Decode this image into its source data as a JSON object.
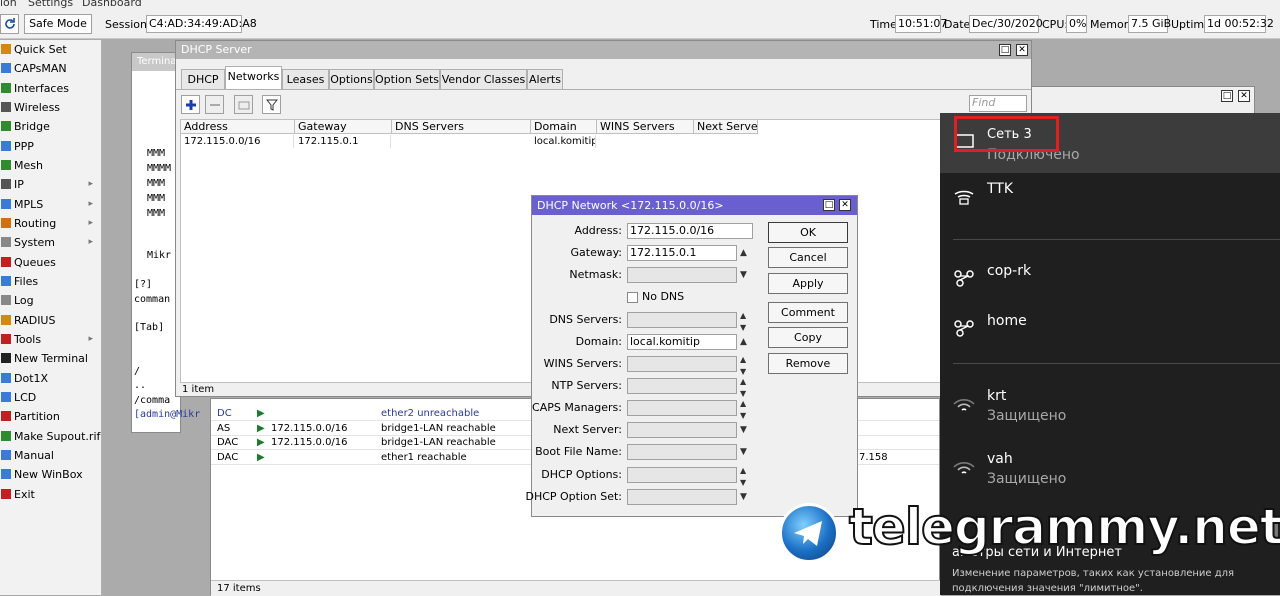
{
  "menu": [
    "ion",
    "Settings",
    "Dashboard"
  ],
  "toolbar": {
    "safe_mode": "Safe Mode",
    "session_label": "Session:",
    "session_value": "C4:AD:34:49:AD:A8",
    "time_label": "Time:",
    "time_value": "10:51:07",
    "date_label": "Date:",
    "date_value": "Dec/30/2020",
    "cpu_label": "CPU:",
    "cpu_value": "0%",
    "memory_label": "Memory:",
    "memory_value": "7.5 GiB",
    "uptime_label": "Uptime:",
    "uptime_value": "1d 00:52:32"
  },
  "sidebar": {
    "items": [
      {
        "label": "Quick Set",
        "icon": "quick-set-icon",
        "color": "#d08a10",
        "submenu": false
      },
      {
        "label": "CAPsMAN",
        "icon": "capsman-icon",
        "color": "#3a7bd5",
        "submenu": false
      },
      {
        "label": "Interfaces",
        "icon": "interfaces-icon",
        "color": "#2e8b2e",
        "submenu": false
      },
      {
        "label": "Wireless",
        "icon": "wireless-icon",
        "color": "#555555",
        "submenu": false
      },
      {
        "label": "Bridge",
        "icon": "bridge-icon",
        "color": "#2e8b2e",
        "submenu": false
      },
      {
        "label": "PPP",
        "icon": "ppp-icon",
        "color": "#3a7bd5",
        "submenu": false
      },
      {
        "label": "Mesh",
        "icon": "mesh-icon",
        "color": "#2e8b2e",
        "submenu": false
      },
      {
        "label": "IP",
        "icon": "ip-icon",
        "color": "#555555",
        "submenu": true
      },
      {
        "label": "MPLS",
        "icon": "mpls-icon",
        "color": "#3a7bd5",
        "submenu": true
      },
      {
        "label": "Routing",
        "icon": "routing-icon",
        "color": "#d07010",
        "submenu": true
      },
      {
        "label": "System",
        "icon": "system-icon",
        "color": "#888888",
        "submenu": true
      },
      {
        "label": "Queues",
        "icon": "queues-icon",
        "color": "#c02020",
        "submenu": false
      },
      {
        "label": "Files",
        "icon": "files-icon",
        "color": "#3a7bd5",
        "submenu": false
      },
      {
        "label": "Log",
        "icon": "log-icon",
        "color": "#888888",
        "submenu": false
      },
      {
        "label": "RADIUS",
        "icon": "radius-icon",
        "color": "#d08a10",
        "submenu": false
      },
      {
        "label": "Tools",
        "icon": "tools-icon",
        "color": "#c02020",
        "submenu": true
      },
      {
        "label": "New Terminal",
        "icon": "terminal-icon",
        "color": "#222222",
        "submenu": false
      },
      {
        "label": "Dot1X",
        "icon": "dot1x-icon",
        "color": "#3a7bd5",
        "submenu": false
      },
      {
        "label": "LCD",
        "icon": "lcd-icon",
        "color": "#3a7bd5",
        "submenu": false
      },
      {
        "label": "Partition",
        "icon": "partition-icon",
        "color": "#c02020",
        "submenu": false
      },
      {
        "label": "Make Supout.rif",
        "icon": "supout-icon",
        "color": "#2e8b2e",
        "submenu": false
      },
      {
        "label": "Manual",
        "icon": "manual-icon",
        "color": "#3a7bd5",
        "submenu": false
      },
      {
        "label": "New WinBox",
        "icon": "winbox-icon",
        "color": "#3a7bd5",
        "submenu": false
      },
      {
        "label": "Exit",
        "icon": "exit-icon",
        "color": "#c02020",
        "submenu": false
      }
    ]
  },
  "terminal": {
    "title": "Termina",
    "lines": [
      "MMM",
      "MMMM",
      "MMM",
      "MMM",
      "MMM",
      "Mikr",
      "[?]",
      "comman",
      "[Tab]",
      "/",
      "..",
      "/comma"
    ],
    "prompt": "[admin@Mikr"
  },
  "dhcp_server": {
    "title": "DHCP Server",
    "tabs": [
      "DHCP",
      "Networks",
      "Leases",
      "Options",
      "Option Sets",
      "Vendor Classes",
      "Alerts"
    ],
    "active_tab": "Networks",
    "find_placeholder": "Find",
    "columns": [
      "Address",
      "Gateway",
      "DNS Servers",
      "Domain",
      "WINS Servers",
      "Next Server"
    ],
    "rows": [
      {
        "address": "172.115.0.0/16",
        "gateway": "172.115.0.1",
        "dns": "",
        "domain": "local.komitip",
        "wins": "",
        "next": ""
      }
    ],
    "status": "1 item"
  },
  "routes": {
    "rows": [
      {
        "flag": "DC",
        "dst": "",
        "gw": "ether2 unreachable",
        "extra": ""
      },
      {
        "flag": "AS",
        "dst": "172.115.0.0/16",
        "gw": "bridge1-LAN reachable",
        "extra": ""
      },
      {
        "flag": "DAC",
        "dst": "172.115.0.0/16",
        "gw": "bridge1-LAN reachable",
        "extra": ""
      },
      {
        "flag": "DAC",
        "dst": "",
        "gw": "ether1 reachable",
        "extra": "7.158"
      }
    ],
    "status": "17 items"
  },
  "dialog": {
    "title": "DHCP Network <172.115.0.0/16>",
    "fields": {
      "address_label": "Address:",
      "address_value": "172.115.0.0/16",
      "gateway_label": "Gateway:",
      "gateway_value": "172.115.0.1",
      "netmask_label": "Netmask:",
      "no_dns_label": "No DNS",
      "dns_label": "DNS Servers:",
      "domain_label": "Domain:",
      "domain_value": "local.komitip",
      "wins_label": "WINS Servers:",
      "ntp_label": "NTP Servers:",
      "caps_label": "CAPS Managers:",
      "next_label": "Next Server:",
      "boot_label": "Boot File Name:",
      "opts_label": "DHCP Options:",
      "optset_label": "DHCP Option Set:"
    },
    "buttons": {
      "ok": "OK",
      "cancel": "Cancel",
      "apply": "Apply",
      "comment": "Comment",
      "copy": "Copy",
      "remove": "Remove"
    }
  },
  "wifi_panel": {
    "networks": [
      {
        "name": "Сеть 3",
        "status": "Подключено",
        "icon": "ethernet-icon"
      },
      {
        "name": "TTK",
        "status": "",
        "icon": "dialup-icon"
      },
      {
        "name": "cop-rk",
        "status": "",
        "icon": "vpn-icon"
      },
      {
        "name": "home",
        "status": "",
        "icon": "vpn-icon"
      },
      {
        "name": "krt",
        "status": "Защищено",
        "icon": "wifi-icon"
      },
      {
        "name": "vah",
        "status": "Защищено",
        "icon": "wifi-icon"
      }
    ],
    "settings_title": "аметры сети и Интернет",
    "settings_desc_1": "Изменение параметров, таких как установление для",
    "settings_desc_2": "подключения значения \"лимитное\"."
  },
  "watermark": {
    "text": "telegrammy.net"
  },
  "colors": {
    "dialog_title": "#6a5fd0",
    "winbox_title": "#b4b4b4",
    "highlight_box": "#e02020",
    "wifi_bg": "#1f1f1f"
  }
}
